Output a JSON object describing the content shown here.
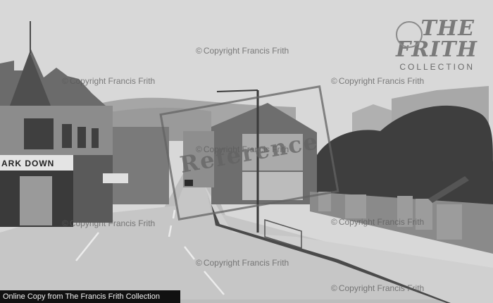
{
  "photo": {
    "subject": "photo-scene",
    "shop_sign": "ARK  DOWN"
  },
  "watermarks": [
    {
      "text": "Copyright Francis Frith"
    },
    {
      "text": "Copyright Francis Frith"
    },
    {
      "text": "Copyright Francis Frith"
    },
    {
      "text": "Copyright Francis Frith"
    },
    {
      "text": "Copyright Francis Frith"
    },
    {
      "text": "Copyright Francis Frith"
    },
    {
      "text": "Copyright Francis Frith"
    },
    {
      "text": "Copyright Francis Frith"
    }
  ],
  "logo": {
    "line1": "THE FRITH",
    "line2": "COLLECTION"
  },
  "stamp": {
    "text": "Reference"
  },
  "caption": {
    "text": "Online Copy from The Francis Frith Collection"
  }
}
